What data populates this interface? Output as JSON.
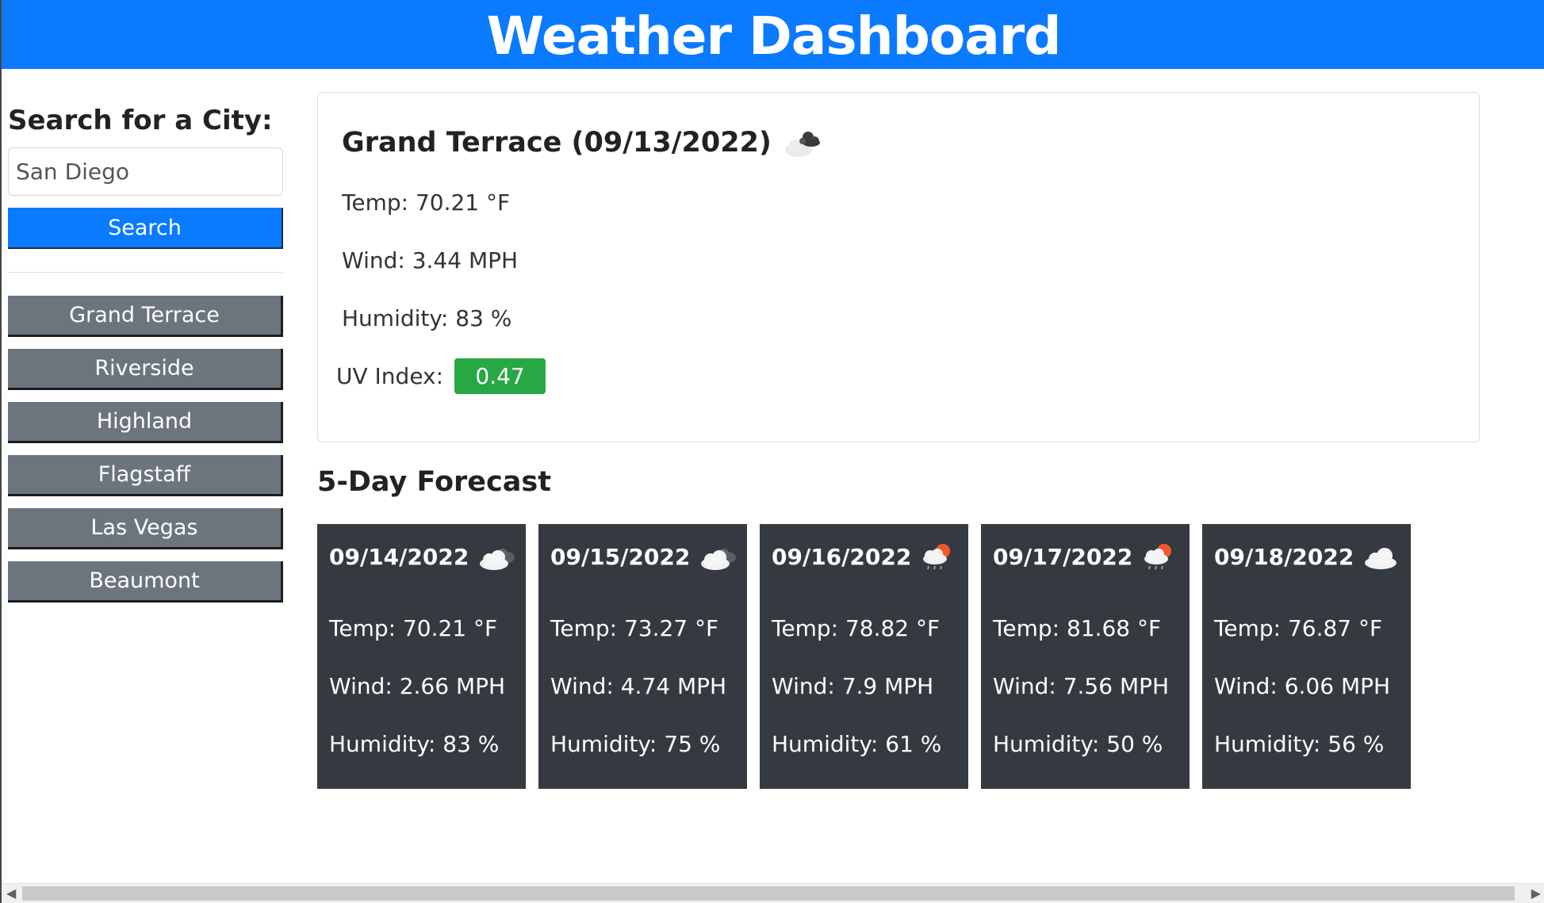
{
  "header": {
    "title": "Weather Dashboard"
  },
  "sidebar": {
    "heading": "Search for a City:",
    "search_value": "San Diego",
    "search_button": "Search",
    "history": [
      "Grand Terrace",
      "Riverside",
      "Highland",
      "Flagstaff",
      "Las Vegas",
      "Beaumont"
    ]
  },
  "current": {
    "title": "Grand Terrace (09/13/2022)",
    "icon": "broken-clouds-icon",
    "temp": "Temp: 70.21 °F",
    "wind": "Wind: 3.44 MPH",
    "humidity": "Humidity: 83 %",
    "uv_label": "UV Index:",
    "uv_value": "0.47",
    "uv_color": "#28a745"
  },
  "forecast": {
    "heading": "5-Day Forecast",
    "days": [
      {
        "date": "09/14/2022",
        "icon": "broken-clouds-icon",
        "temp": "Temp: 70.21 °F",
        "wind": "Wind: 2.66 MPH",
        "humidity": "Humidity: 83 %"
      },
      {
        "date": "09/15/2022",
        "icon": "broken-clouds-icon",
        "temp": "Temp: 73.27 °F",
        "wind": "Wind: 4.74 MPH",
        "humidity": "Humidity: 75 %"
      },
      {
        "date": "09/16/2022",
        "icon": "rain-sun-icon",
        "temp": "Temp: 78.82 °F",
        "wind": "Wind: 7.9 MPH",
        "humidity": "Humidity: 61 %"
      },
      {
        "date": "09/17/2022",
        "icon": "rain-sun-icon",
        "temp": "Temp: 81.68 °F",
        "wind": "Wind: 7.56 MPH",
        "humidity": "Humidity: 50 %"
      },
      {
        "date": "09/18/2022",
        "icon": "cloud-icon",
        "temp": "Temp: 76.87 °F",
        "wind": "Wind: 6.06 MPH",
        "humidity": "Humidity: 56 %"
      }
    ]
  },
  "colors": {
    "header_bg": "#0a7aff",
    "history_button_bg": "#6c757d",
    "forecast_card_bg": "#343a40"
  }
}
